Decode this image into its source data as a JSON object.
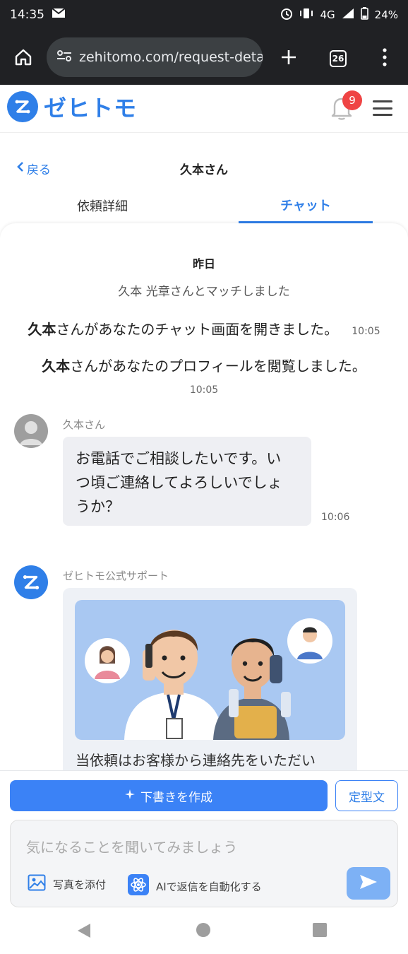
{
  "status_bar": {
    "time": "14:35",
    "network": "4G",
    "battery": "24%",
    "icons": [
      "mail-icon",
      "alarm-icon",
      "vibrate-icon",
      "signal-icon",
      "battery-icon"
    ]
  },
  "browser": {
    "url": "zehitomo.com/request-detail/",
    "tab_count": "26",
    "icons": [
      "home-icon",
      "site-settings-icon",
      "new-tab-icon",
      "tab-switcher-icon",
      "more-menu-icon"
    ]
  },
  "header": {
    "logo_text": "ゼヒトモ",
    "notification_count": "9",
    "brand_color": "#2f7fe8"
  },
  "page": {
    "back_label": "戻る",
    "title": "久本さん"
  },
  "tabs": {
    "request_detail": "依頼詳細",
    "chat": "チャット",
    "active": "チャット"
  },
  "chat": {
    "day_label": "昨日",
    "match_message": "久本 光章さんとマッチしました",
    "system_messages": [
      {
        "name": "久本",
        "text": "さんがあなたのチャット画面を開きました。",
        "time": "10:05"
      },
      {
        "name": "久本",
        "text": "さんがあなたのプロフィールを閲覧しました。",
        "time": "10:05"
      }
    ],
    "messages": [
      {
        "sender": "久本さん",
        "lines": [
          "お電話でご相談したいです。い",
          "つ頃ご連絡してよろしいでしょ",
          "うか？"
        ],
        "time": "10:06"
      },
      {
        "sender": "ゼヒトモ公式サポート",
        "card_text": "当依頼はお客様から連絡先をいただい"
      }
    ]
  },
  "composer": {
    "draft_button": "下書きを作成",
    "template_button": "定型文",
    "placeholder": "気になることを聞いてみましょう",
    "attach_photo": "写真を添付",
    "ai_automate": "AIで返信を自動化する"
  }
}
